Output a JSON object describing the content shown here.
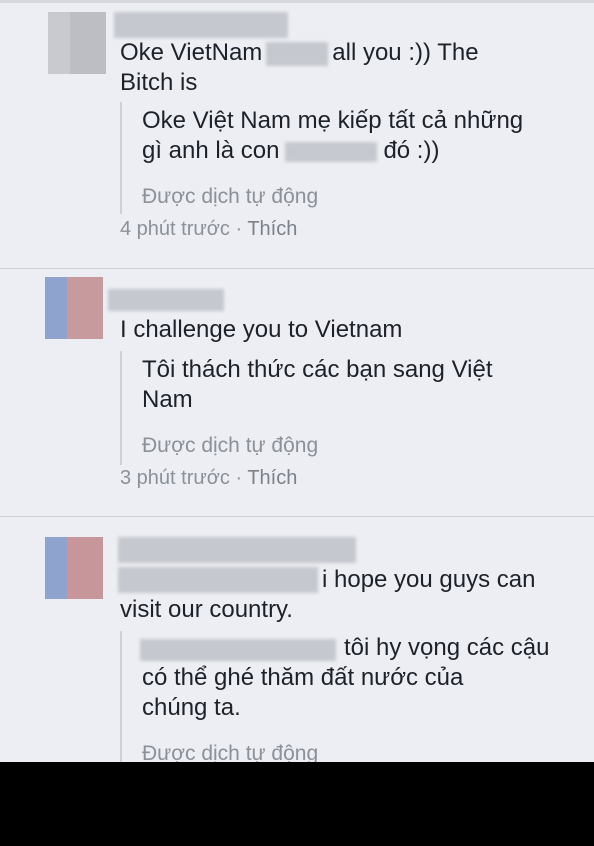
{
  "colors": {
    "background": "#eceef3",
    "text": "#1d2129",
    "meta": "#8b9099",
    "divider": "#cfd2d8"
  },
  "comments": [
    {
      "text_line1_a": "Oke VietNam",
      "text_line1_b": "all you :)) The",
      "text_line2": "Bitch is",
      "translation_line1": "Oke Việt Nam mẹ kiếp tất cả những",
      "translation_line2_a": "gì anh là con",
      "translation_line2_b": "đó :))",
      "auto_label": "Được dịch tự động",
      "time": "4 phút trước",
      "separator": " · ",
      "like": "Thích",
      "avatar_colors": [
        "#c9cacf",
        "#bdbec4"
      ]
    },
    {
      "text_line1": "I challenge you to Vietnam",
      "translation_line1": "Tôi thách thức các bạn sang Việt",
      "translation_line2": "Nam",
      "auto_label": "Được dịch tự động",
      "time": "3 phút trước",
      "separator": " · ",
      "like": "Thích",
      "avatar_colors": [
        "#8fa3cf",
        "#c79a9e"
      ]
    },
    {
      "text_line1": "i hope you guys can",
      "text_line2": "visit our country.",
      "translation_line1": "tôi hy vọng các cậu",
      "translation_line2": "có thể ghé thăm đất nước của",
      "translation_line3": "chúng ta.",
      "auto_label": "Được dịch tự động",
      "avatar_colors": [
        "#8fa3cf",
        "#c7969a"
      ]
    }
  ]
}
